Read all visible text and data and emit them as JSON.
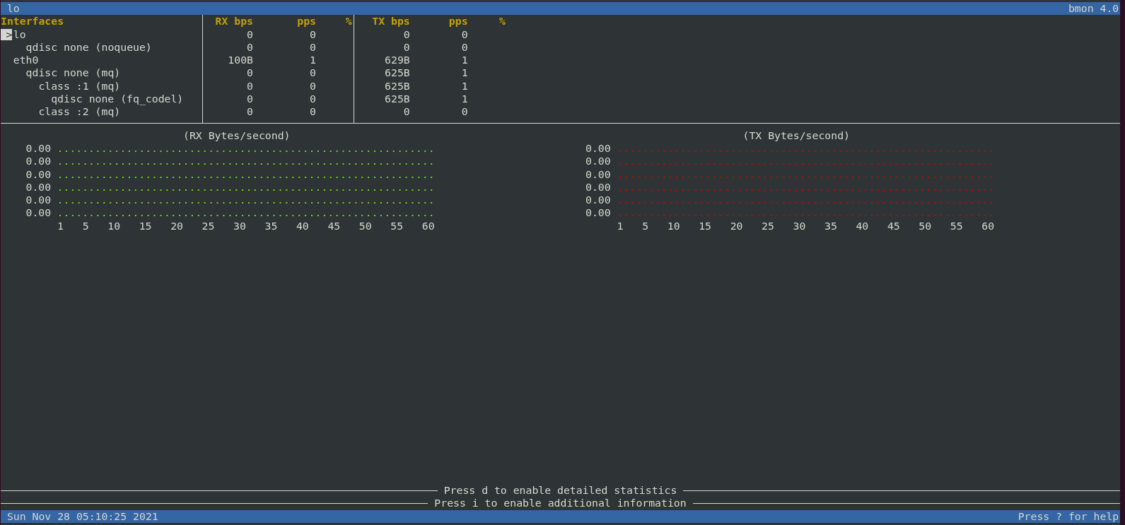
{
  "title_bar": {
    "title": "lo",
    "app": "bmon 4.0"
  },
  "table": {
    "columns": {
      "interfaces": "Interfaces",
      "rx_bps": "RX bps",
      "rx_pps": "pps",
      "rx_pct": "%",
      "tx_bps": "TX bps",
      "tx_pps": "pps",
      "tx_pct": "%"
    },
    "cursor": ">",
    "rows": [
      {
        "name": "lo",
        "selected": true,
        "rx_bps": "0",
        "rx_pps": "0",
        "tx_bps": "0",
        "tx_pps": "0",
        "children": [
          {
            "name": "qdisc none (noqueue)",
            "selected": false,
            "rx_bps": "0",
            "rx_pps": "0",
            "tx_bps": "0",
            "tx_pps": "0"
          }
        ]
      },
      {
        "name": "eth0",
        "selected": false,
        "rx_bps": "100B",
        "rx_pps": "1",
        "tx_bps": "629B",
        "tx_pps": "1",
        "children": [
          {
            "name": "qdisc none (mq)",
            "selected": false,
            "rx_bps": "0",
            "rx_pps": "0",
            "tx_bps": "625B",
            "tx_pps": "1",
            "children": [
              {
                "name": "class :1 (mq)",
                "selected": false,
                "rx_bps": "0",
                "rx_pps": "0",
                "tx_bps": "625B",
                "tx_pps": "1",
                "children": [
                  {
                    "name": "qdisc none (fq_codel)",
                    "selected": false,
                    "rx_bps": "0",
                    "rx_pps": "0",
                    "tx_bps": "625B",
                    "tx_pps": "1"
                  }
                ]
              },
              {
                "name": "class :2 (mq)",
                "selected": false,
                "rx_bps": "0",
                "rx_pps": "0",
                "tx_bps": "0",
                "tx_pps": "0"
              }
            ]
          }
        ]
      }
    ]
  },
  "graphs": [
    {
      "title": "(RX Bytes/second)",
      "color": "#73d216",
      "y_labels": [
        "0.00",
        "0.00",
        "0.00",
        "0.00",
        "0.00",
        "0.00"
      ],
      "x_labels": [
        "1",
        "5",
        "10",
        "15",
        "20",
        "25",
        "30",
        "35",
        "40",
        "45",
        "50",
        "55",
        "60"
      ]
    },
    {
      "title": "(TX Bytes/second)",
      "color": "#cc0000",
      "y_labels": [
        "0.00",
        "0.00",
        "0.00",
        "0.00",
        "0.00",
        "0.00"
      ],
      "x_labels": [
        "1",
        "5",
        "10",
        "15",
        "20",
        "25",
        "30",
        "35",
        "40",
        "45",
        "50",
        "55",
        "60"
      ]
    }
  ],
  "hints": [
    "Press d to enable detailed statistics",
    "Press i to enable additional information"
  ],
  "status_bar": {
    "datetime": "Sun Nov 28 05:10:25 2021",
    "help": "Press ? for help"
  }
}
